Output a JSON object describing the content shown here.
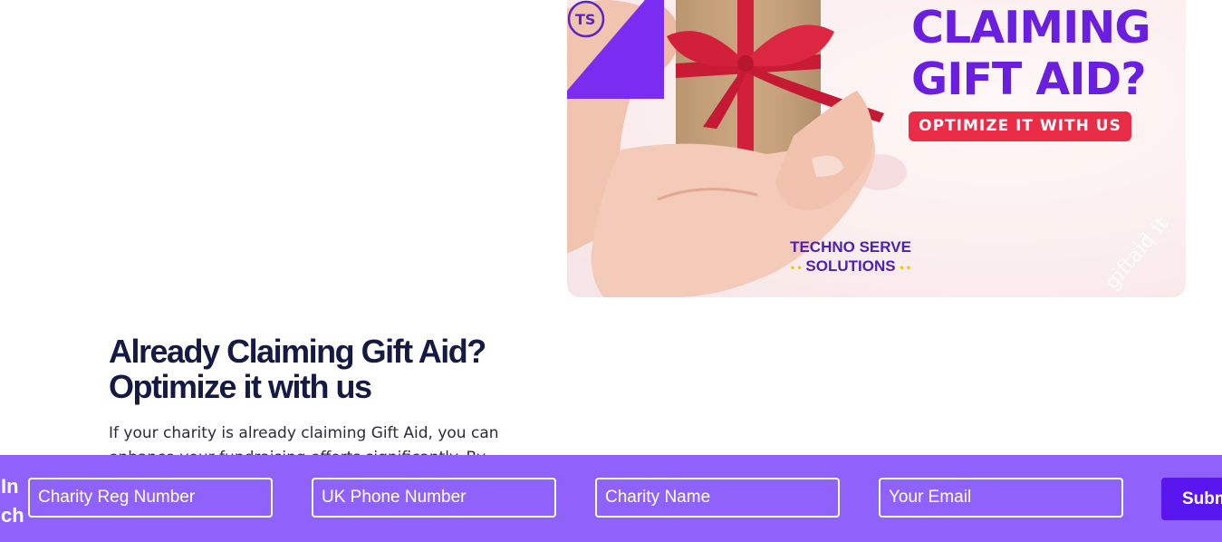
{
  "banner": {
    "headline_line1": "CLAIMING",
    "headline_line2": "GIFT AID?",
    "pill_text": "OPTIMIZE IT WITH US",
    "brand_line1": "TECHNO SERVE",
    "brand_line2": "SOLUTIONS",
    "brand_dots": "• •",
    "corner_text": "giftaid it",
    "colors": {
      "headline": "#6a1fe0",
      "pill": "#ea2c46",
      "ribbon": "#7a2cf0",
      "gift_bow": "#d3203a",
      "gift_box": "#c9a27a"
    }
  },
  "section": {
    "title": "Already Claiming Gift Aid? Optimize it with us",
    "body": "If your charity is already claiming Gift Aid, you can enhance your fundraising efforts significantly. By"
  },
  "form": {
    "label_line1": "In",
    "label_line2": "ch",
    "fields": {
      "charity_reg": "Charity Reg Number",
      "phone": "UK Phone Number",
      "charity_name": "Charity Name",
      "email": "Your Email"
    },
    "submit_label": "Submit",
    "colors": {
      "bar": "#8f63fb",
      "button": "#5a16ee"
    }
  }
}
